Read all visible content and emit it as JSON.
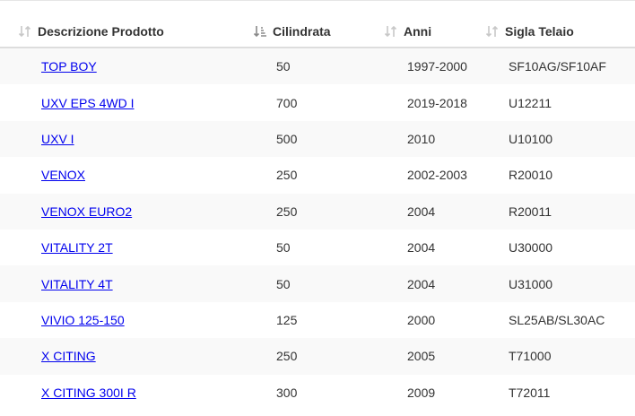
{
  "table": {
    "headers": [
      {
        "label": "Descrizione Prodotto",
        "sort_icon": "sort-both-icon"
      },
      {
        "label": "Cilindrata",
        "sort_icon": "sort-ascending-icon"
      },
      {
        "label": "Anni",
        "sort_icon": "sort-both-icon"
      },
      {
        "label": "Sigla Telaio",
        "sort_icon": "sort-both-icon"
      }
    ],
    "rows": [
      {
        "product": "TOP BOY",
        "cc": "50",
        "years": "1997-2000",
        "frame": "SF10AG/SF10AF"
      },
      {
        "product": "UXV EPS 4WD I",
        "cc": "700",
        "years": "2019-2018",
        "frame": "U12211"
      },
      {
        "product": "UXV I",
        "cc": "500",
        "years": "2010",
        "frame": "U10100"
      },
      {
        "product": "VENOX",
        "cc": "250",
        "years": "2002-2003",
        "frame": "R20010"
      },
      {
        "product": "VENOX EURO2",
        "cc": "250",
        "years": "2004",
        "frame": "R20011"
      },
      {
        "product": "VITALITY 2T",
        "cc": "50",
        "years": "2004",
        "frame": "U30000"
      },
      {
        "product": "VITALITY 4T",
        "cc": "50",
        "years": "2004",
        "frame": "U31000"
      },
      {
        "product": "VIVIO 125-150",
        "cc": "125",
        "years": "2000",
        "frame": "SL25AB/SL30AC"
      },
      {
        "product": "X CITING",
        "cc": "250",
        "years": "2005",
        "frame": "T71000"
      },
      {
        "product": "X CITING 300I R",
        "cc": "300",
        "years": "2009",
        "frame": "T72011"
      }
    ]
  },
  "colors": {
    "link": "#3a7cb8",
    "stripe": "#f9f9f9",
    "border": "#dddddd",
    "sort_inactive": "#c8c8c8",
    "sort_active": "#8a8a8a"
  }
}
